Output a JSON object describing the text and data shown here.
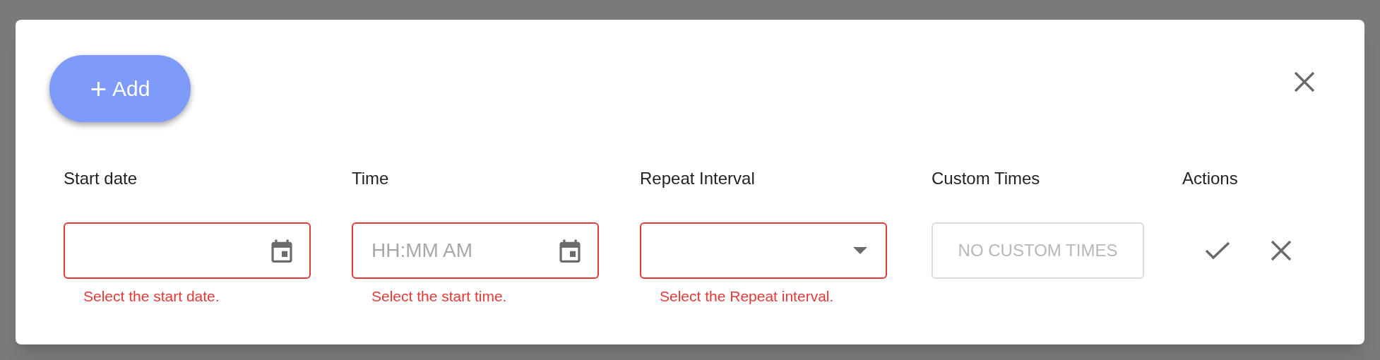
{
  "dialog": {
    "add_button": {
      "icon": "+",
      "label": "Add"
    },
    "columns": [
      {
        "kind": "date",
        "label": "Start date",
        "error": "Select the start date."
      },
      {
        "kind": "date",
        "label": "Time",
        "placeholder": "HH:MM AM",
        "error": "Select the start time."
      },
      {
        "kind": "select",
        "label": "Repeat Interval",
        "error": "Select the Repeat interval."
      },
      {
        "kind": "disabled",
        "label": "Custom Times",
        "placeholder": "NO CUSTOM TIMES"
      },
      {
        "kind": "actions",
        "label": "Actions"
      }
    ]
  }
}
